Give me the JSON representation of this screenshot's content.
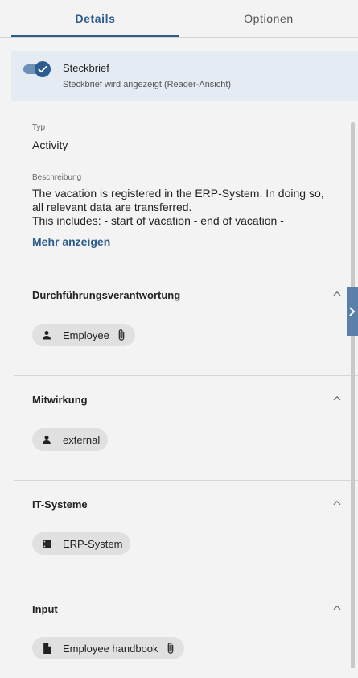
{
  "tabs": [
    {
      "label": "Details",
      "active": true
    },
    {
      "label": "Optionen",
      "active": false
    }
  ],
  "toggle": {
    "title": "Steckbrief",
    "subtitle": "Steckbrief wird angezeigt (Reader-Ansicht)",
    "checked": true
  },
  "details": {
    "type_label": "Typ",
    "type_value": "Activity",
    "description_label": "Beschreibung",
    "description_lines": [
      "The vacation is registered in the ERP-System. In doing so,",
      "all relevant data are transferred.",
      "This includes: - start of vacation - end of vacation -"
    ],
    "more_link": "Mehr anzeigen"
  },
  "sections": [
    {
      "title": "Durchführungsverantwortung",
      "chip": {
        "label": "Employee",
        "icon": "person-icon",
        "attachment": true
      }
    },
    {
      "title": "Mitwirkung",
      "chip": {
        "label": "external",
        "icon": "person-icon",
        "attachment": false
      }
    },
    {
      "title": "IT-Systeme",
      "chip": {
        "label": "ERP-System",
        "icon": "server-icon",
        "attachment": false
      }
    },
    {
      "title": "Input",
      "chip": {
        "label": "Employee handbook",
        "icon": "document-icon",
        "attachment": true
      }
    }
  ],
  "colors": {
    "accent": "#2d5c8e",
    "background": "#f3f3f3",
    "toggle_card": "#e5ebf2",
    "chip": "#e0e0e0"
  }
}
